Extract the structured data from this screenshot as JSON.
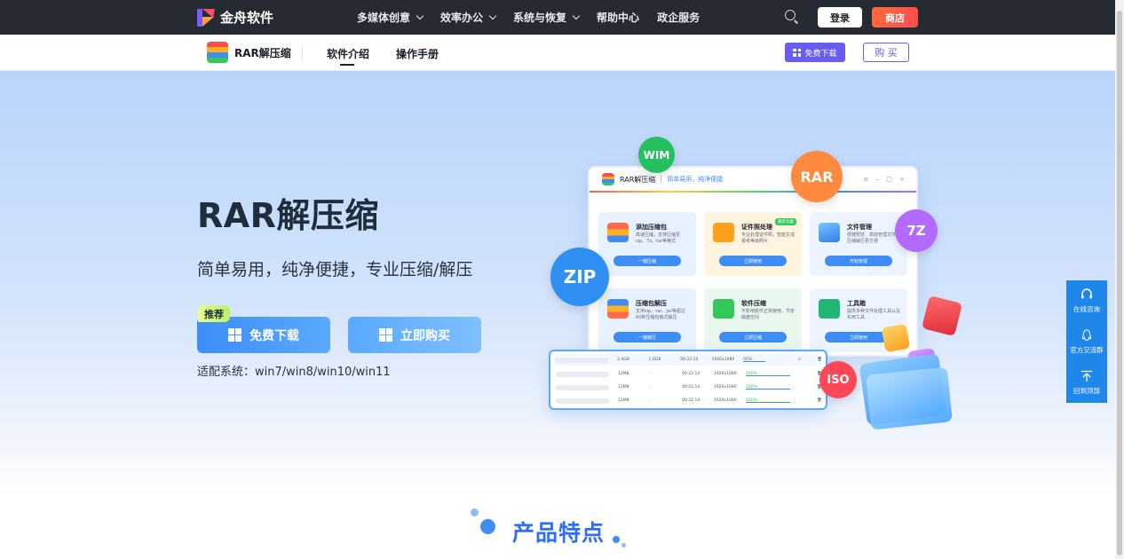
{
  "topnav": {
    "brand": "金舟软件",
    "menu": [
      {
        "label": "多媒体创意",
        "has_dropdown": true
      },
      {
        "label": "效率办公",
        "has_dropdown": true
      },
      {
        "label": "系统与恢复",
        "has_dropdown": true
      },
      {
        "label": "帮助中心",
        "has_dropdown": false
      },
      {
        "label": "政企服务",
        "has_dropdown": false
      }
    ],
    "login_label": "登录",
    "shop_label": "商店"
  },
  "subnav": {
    "product_name": "RAR解压缩",
    "tabs": [
      {
        "label": "软件介绍",
        "active": true
      },
      {
        "label": "操作手册",
        "active": false
      }
    ],
    "download_label": "免费下载",
    "buy_label": "购 买"
  },
  "hero": {
    "title": "RAR解压缩",
    "subtitle": "简单易用，纯净便捷，专业压缩/解压",
    "badge": "推荐",
    "download_label": "免费下载",
    "buy_label": "立即购买",
    "compat": "适配系统：win7/win8/win10/win11"
  },
  "illustration": {
    "app_title": "RAR解压缩",
    "app_slogan": "简单易用，纯净便捷",
    "cards": [
      {
        "title": "添加压缩包",
        "desc": "高速压缩，支持压缩至zip、7z、tar等格式",
        "button": "一键压缩",
        "color": "#e8f2ff"
      },
      {
        "title": "证件照处理",
        "desc": "专业处理证件照，智能生成报考等级照片",
        "button": "立即使用",
        "color": "#fff4e0",
        "tag": "最新功能"
      },
      {
        "title": "文件管理",
        "desc": "便捷预览、高效管理文件，压缩解压更方便",
        "button": "开始管理",
        "color": "#eef4ff"
      },
      {
        "title": "压缩包解压",
        "desc": "支持zip、rar、jar等超过60种压缩包格式解压",
        "button": "一键解压",
        "color": "#e8f2ff"
      },
      {
        "title": "软件压缩",
        "desc": "不影响软件正常使用，节省磁盘空间",
        "button": "立即压缩",
        "color": "#e9f8ef"
      },
      {
        "title": "工具箱",
        "desc": "提供多种文件处理工具以及实用工具",
        "button": "立即使用",
        "color": "#eef4ff"
      }
    ],
    "table_rows": [
      {
        "size": "2.4GB",
        "size2": "1.6GB",
        "time": "00:22:14",
        "res": "1920x1080",
        "status": "50%",
        "progress": 0.5
      },
      {
        "size": "12MB",
        "size2": "-",
        "time": "00:22:14",
        "res": "1920x1080",
        "status": "100%",
        "progress": 1.0
      },
      {
        "size": "12MB",
        "size2": "-",
        "time": "00:22:14",
        "res": "1920x1080",
        "status": "100%",
        "progress": 1.0
      },
      {
        "size": "12MB",
        "size2": "-",
        "time": "00:22:14",
        "res": "1920x1080",
        "status": "100%",
        "progress": 1.0
      }
    ],
    "bubbles": [
      "WIM",
      "RAR",
      "7Z",
      "ZIP",
      "ISO"
    ]
  },
  "float_bar": {
    "items": [
      "在线咨询",
      "官方交流群",
      "回到顶部"
    ]
  },
  "features": {
    "title": "产品特点"
  },
  "colors": {
    "accent": "#3d8df5",
    "purple": "#6b5cf0",
    "shop": "#ff5a3c",
    "nav_bg": "#262a33"
  }
}
